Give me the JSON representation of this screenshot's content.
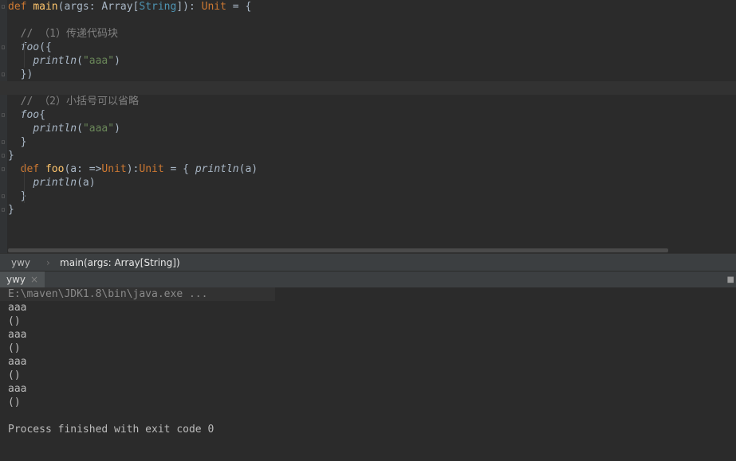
{
  "editor": {
    "lines": [
      {
        "tokens": [
          {
            "t": "def ",
            "c": "kw"
          },
          {
            "t": "main",
            "c": "fn"
          },
          {
            "t": "(args: Array[",
            "c": ""
          },
          {
            "t": "String",
            "c": "typ"
          },
          {
            "t": "]): ",
            "c": ""
          },
          {
            "t": "Unit",
            "c": "kw"
          },
          {
            "t": " = {",
            "c": ""
          }
        ]
      },
      {
        "tokens": []
      },
      {
        "tokens": [
          {
            "t": "  // （1）传递代码块",
            "c": "cmt"
          }
        ]
      },
      {
        "tokens": [
          {
            "t": "  ",
            "c": ""
          },
          {
            "t": "foo",
            "c": "ital"
          },
          {
            "t": "({",
            "c": ""
          }
        ]
      },
      {
        "tokens": [
          {
            "t": "    ",
            "c": ""
          },
          {
            "t": "println",
            "c": "ital"
          },
          {
            "t": "(",
            "c": ""
          },
          {
            "t": "\"aaa\"",
            "c": "str"
          },
          {
            "t": ")",
            "c": ""
          }
        ]
      },
      {
        "tokens": [
          {
            "t": "  })",
            "c": ""
          }
        ]
      },
      {
        "tokens": []
      },
      {
        "tokens": [
          {
            "t": "  // （2）小括号可以省略",
            "c": "cmt"
          }
        ]
      },
      {
        "tokens": [
          {
            "t": "  ",
            "c": ""
          },
          {
            "t": "foo",
            "c": "ital"
          },
          {
            "t": "{",
            "c": ""
          }
        ]
      },
      {
        "tokens": [
          {
            "t": "    ",
            "c": ""
          },
          {
            "t": "println",
            "c": "ital"
          },
          {
            "t": "(",
            "c": ""
          },
          {
            "t": "\"aaa\"",
            "c": "str"
          },
          {
            "t": ")",
            "c": ""
          }
        ]
      },
      {
        "tokens": [
          {
            "t": "  }",
            "c": ""
          }
        ]
      },
      {
        "tokens": [
          {
            "t": "}",
            "c": ""
          }
        ]
      },
      {
        "tokens": [
          {
            "t": "  ",
            "c": ""
          },
          {
            "t": "def ",
            "c": "kw"
          },
          {
            "t": "foo",
            "c": "fn"
          },
          {
            "t": "(a: =>",
            "c": ""
          },
          {
            "t": "Unit",
            "c": "kw"
          },
          {
            "t": "):",
            "c": ""
          },
          {
            "t": "Unit",
            "c": "kw"
          },
          {
            "t": " = { ",
            "c": ""
          },
          {
            "t": "println",
            "c": "ital"
          },
          {
            "t": "(a)",
            "c": ""
          }
        ]
      },
      {
        "tokens": [
          {
            "t": "    ",
            "c": ""
          },
          {
            "t": "println",
            "c": "ital"
          },
          {
            "t": "(a)",
            "c": ""
          }
        ]
      },
      {
        "tokens": [
          {
            "t": "  }",
            "c": ""
          }
        ]
      },
      {
        "tokens": [
          {
            "t": "}",
            "c": ""
          }
        ]
      }
    ]
  },
  "breadcrumb": {
    "object": "ywy",
    "separator": "›",
    "method": "main(args: Array[String])"
  },
  "run_panel": {
    "tab_label": "ywy",
    "close_glyph": "×"
  },
  "console": {
    "command": "E:\\maven\\JDK1.8\\bin\\java.exe ...",
    "output": [
      "aaa",
      "()",
      "aaa",
      "()",
      "aaa",
      "()",
      "aaa",
      "()",
      "",
      "Process finished with exit code 0"
    ]
  },
  "colors": {
    "keyword": "#cc7832",
    "function": "#ffc66d",
    "string": "#6a8759",
    "type": "#4e94b3",
    "comment": "#808080",
    "text": "#a9b7c6",
    "background": "#2b2b2b"
  }
}
